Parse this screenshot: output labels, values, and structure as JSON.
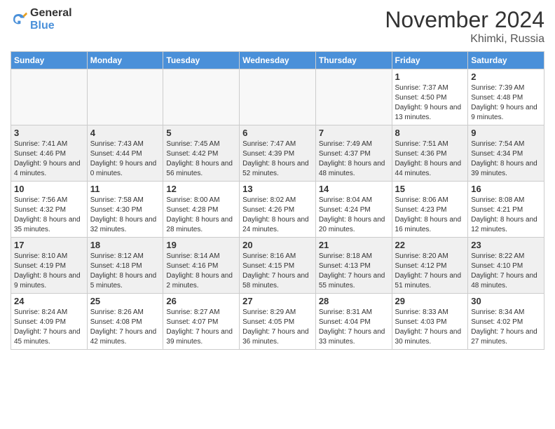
{
  "logo": {
    "general": "General",
    "blue": "Blue"
  },
  "header": {
    "month_year": "November 2024",
    "location": "Khimki, Russia"
  },
  "weekdays": [
    "Sunday",
    "Monday",
    "Tuesday",
    "Wednesday",
    "Thursday",
    "Friday",
    "Saturday"
  ],
  "weeks": [
    [
      {
        "num": "",
        "info": ""
      },
      {
        "num": "",
        "info": ""
      },
      {
        "num": "",
        "info": ""
      },
      {
        "num": "",
        "info": ""
      },
      {
        "num": "",
        "info": ""
      },
      {
        "num": "1",
        "info": "Sunrise: 7:37 AM\nSunset: 4:50 PM\nDaylight: 9 hours and 13 minutes."
      },
      {
        "num": "2",
        "info": "Sunrise: 7:39 AM\nSunset: 4:48 PM\nDaylight: 9 hours and 9 minutes."
      }
    ],
    [
      {
        "num": "3",
        "info": "Sunrise: 7:41 AM\nSunset: 4:46 PM\nDaylight: 9 hours and 4 minutes."
      },
      {
        "num": "4",
        "info": "Sunrise: 7:43 AM\nSunset: 4:44 PM\nDaylight: 9 hours and 0 minutes."
      },
      {
        "num": "5",
        "info": "Sunrise: 7:45 AM\nSunset: 4:42 PM\nDaylight: 8 hours and 56 minutes."
      },
      {
        "num": "6",
        "info": "Sunrise: 7:47 AM\nSunset: 4:39 PM\nDaylight: 8 hours and 52 minutes."
      },
      {
        "num": "7",
        "info": "Sunrise: 7:49 AM\nSunset: 4:37 PM\nDaylight: 8 hours and 48 minutes."
      },
      {
        "num": "8",
        "info": "Sunrise: 7:51 AM\nSunset: 4:36 PM\nDaylight: 8 hours and 44 minutes."
      },
      {
        "num": "9",
        "info": "Sunrise: 7:54 AM\nSunset: 4:34 PM\nDaylight: 8 hours and 39 minutes."
      }
    ],
    [
      {
        "num": "10",
        "info": "Sunrise: 7:56 AM\nSunset: 4:32 PM\nDaylight: 8 hours and 35 minutes."
      },
      {
        "num": "11",
        "info": "Sunrise: 7:58 AM\nSunset: 4:30 PM\nDaylight: 8 hours and 32 minutes."
      },
      {
        "num": "12",
        "info": "Sunrise: 8:00 AM\nSunset: 4:28 PM\nDaylight: 8 hours and 28 minutes."
      },
      {
        "num": "13",
        "info": "Sunrise: 8:02 AM\nSunset: 4:26 PM\nDaylight: 8 hours and 24 minutes."
      },
      {
        "num": "14",
        "info": "Sunrise: 8:04 AM\nSunset: 4:24 PM\nDaylight: 8 hours and 20 minutes."
      },
      {
        "num": "15",
        "info": "Sunrise: 8:06 AM\nSunset: 4:23 PM\nDaylight: 8 hours and 16 minutes."
      },
      {
        "num": "16",
        "info": "Sunrise: 8:08 AM\nSunset: 4:21 PM\nDaylight: 8 hours and 12 minutes."
      }
    ],
    [
      {
        "num": "17",
        "info": "Sunrise: 8:10 AM\nSunset: 4:19 PM\nDaylight: 8 hours and 9 minutes."
      },
      {
        "num": "18",
        "info": "Sunrise: 8:12 AM\nSunset: 4:18 PM\nDaylight: 8 hours and 5 minutes."
      },
      {
        "num": "19",
        "info": "Sunrise: 8:14 AM\nSunset: 4:16 PM\nDaylight: 8 hours and 2 minutes."
      },
      {
        "num": "20",
        "info": "Sunrise: 8:16 AM\nSunset: 4:15 PM\nDaylight: 7 hours and 58 minutes."
      },
      {
        "num": "21",
        "info": "Sunrise: 8:18 AM\nSunset: 4:13 PM\nDaylight: 7 hours and 55 minutes."
      },
      {
        "num": "22",
        "info": "Sunrise: 8:20 AM\nSunset: 4:12 PM\nDaylight: 7 hours and 51 minutes."
      },
      {
        "num": "23",
        "info": "Sunrise: 8:22 AM\nSunset: 4:10 PM\nDaylight: 7 hours and 48 minutes."
      }
    ],
    [
      {
        "num": "24",
        "info": "Sunrise: 8:24 AM\nSunset: 4:09 PM\nDaylight: 7 hours and 45 minutes."
      },
      {
        "num": "25",
        "info": "Sunrise: 8:26 AM\nSunset: 4:08 PM\nDaylight: 7 hours and 42 minutes."
      },
      {
        "num": "26",
        "info": "Sunrise: 8:27 AM\nSunset: 4:07 PM\nDaylight: 7 hours and 39 minutes."
      },
      {
        "num": "27",
        "info": "Sunrise: 8:29 AM\nSunset: 4:05 PM\nDaylight: 7 hours and 36 minutes."
      },
      {
        "num": "28",
        "info": "Sunrise: 8:31 AM\nSunset: 4:04 PM\nDaylight: 7 hours and 33 minutes."
      },
      {
        "num": "29",
        "info": "Sunrise: 8:33 AM\nSunset: 4:03 PM\nDaylight: 7 hours and 30 minutes."
      },
      {
        "num": "30",
        "info": "Sunrise: 8:34 AM\nSunset: 4:02 PM\nDaylight: 7 hours and 27 minutes."
      }
    ]
  ]
}
